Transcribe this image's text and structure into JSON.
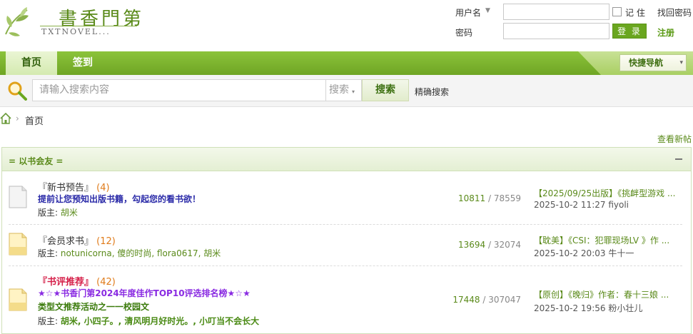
{
  "logo": {
    "title": "書香門第",
    "subtitle": "TXTNOVEL..."
  },
  "login": {
    "username_label": "用户名",
    "username_caret": "▼",
    "password_label": "密码",
    "remember_label": "记 住",
    "forgot_password": "找回密码",
    "login_button": "登 录",
    "register": "注册"
  },
  "nav": {
    "items": [
      {
        "label": "首页"
      },
      {
        "label": "签到"
      }
    ],
    "quick_nav": "快捷导航",
    "quick_nav_caret": "▾"
  },
  "search": {
    "placeholder": "请输入搜索内容",
    "type": "搜索",
    "type_caret": "▾",
    "button": "搜索",
    "precise": "精确搜索"
  },
  "breadcrumb": {
    "separator": "›",
    "home": "首页"
  },
  "new_posts_link": "查看新帖",
  "category": {
    "title": "= 以书会友 =",
    "forums": [
      {
        "name": "『新书预告』",
        "count": "(4)",
        "desc_lines": [
          "提前让您预知出版书籍，勾起您的看书欲！"
        ],
        "desc_color": "#2a2aa8",
        "mod_label": "版主:",
        "mods": "胡米",
        "threads": "10811",
        "posts": "78559",
        "last_title": "【2025/09/25出版】《挑衅型游戏 ...",
        "last_meta": "2025-10-2 11:27 fiyoli"
      },
      {
        "name": "『会员求书』",
        "count": "(12)",
        "desc_lines": [],
        "mod_label": "版主:",
        "mods": "notunicorna, 傻的时尚, flora0617, 胡米",
        "threads": "13694",
        "posts": "32074",
        "last_title": "【耽美】《CSI：犯罪现场LV 》作 ...",
        "last_meta": "2025-10-2 20:03 牛十一"
      },
      {
        "name": "『书评推荐』",
        "count": "(42)",
        "desc_lines": [
          "★☆★书香门第2024年度佳作TOP10评选排名榜★☆★",
          "类型文推荐活动之一一校园文"
        ],
        "desc_colors": [
          "#8a2be2",
          "#3a7a0a"
        ],
        "mod_label": "版主:",
        "mods": "胡米, 小四子。, 清风明月好时光。, 小叮当不会长大",
        "threads": "17448",
        "posts": "307047",
        "last_title": "【原创】《晚归》作者：春十三娘 ...",
        "last_meta": "2025-10-2 19:56 粉小壮儿"
      }
    ]
  },
  "colors": {
    "brand_green": "#6fa524",
    "link_green": "#5a8a1a",
    "count_orange": "#e07b1a",
    "special_red": "#d6214a"
  }
}
